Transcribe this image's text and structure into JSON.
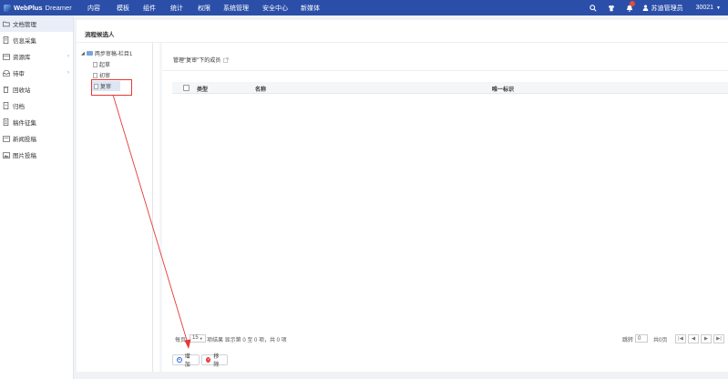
{
  "app": {
    "brand": "WebPlus",
    "brand_suffix": "Dreamer"
  },
  "topnav": {
    "items": [
      "内容",
      "模板",
      "组件",
      "统计",
      "权限",
      "系统管理",
      "安全中心",
      "新媒体"
    ],
    "user": "苏迪管理员",
    "site_id": "30021"
  },
  "sidebar": {
    "items": [
      {
        "label": "文档管理",
        "icon": "folder-open-icon",
        "chevron": false
      },
      {
        "label": "信息采集",
        "icon": "document-icon",
        "chevron": false
      },
      {
        "label": "资源库",
        "icon": "database-icon",
        "chevron": true
      },
      {
        "label": "待审",
        "icon": "inbox-icon",
        "chevron": true
      },
      {
        "label": "回收站",
        "icon": "trash-icon",
        "chevron": false
      },
      {
        "label": "归档",
        "icon": "archive-icon",
        "chevron": false
      },
      {
        "label": "稿件征集",
        "icon": "submission-icon",
        "chevron": false
      },
      {
        "label": "新闻投稿",
        "icon": "news-icon",
        "chevron": false
      },
      {
        "label": "图片投稿",
        "icon": "image-icon",
        "chevron": false
      }
    ]
  },
  "main": {
    "title": "流程候选人"
  },
  "tree": {
    "root": "两步审稿-栏目1",
    "children": [
      "起草",
      "初审",
      "复审"
    ]
  },
  "panel": {
    "title": "管理\"复审\"下的成员"
  },
  "table": {
    "columns": [
      "类型",
      "名称",
      "唯一标识"
    ]
  },
  "pager": {
    "per_page_label": "每页",
    "per_page_value": "15",
    "summary": "项结果 显示第 0 至 0 项，共 0 项",
    "jump_label": "跳转",
    "jump_value": "0",
    "total_pages": "共0页",
    "first": "|◀",
    "prev": "◀",
    "next": "▶",
    "last": "▶|"
  },
  "actions": {
    "add": "增加",
    "remove": "移除"
  },
  "colors": {
    "nav_bg": "#2b4fa8",
    "highlight": "#e53935",
    "add_icon": "#2b68d8",
    "remove_icon": "#e23b3b"
  }
}
